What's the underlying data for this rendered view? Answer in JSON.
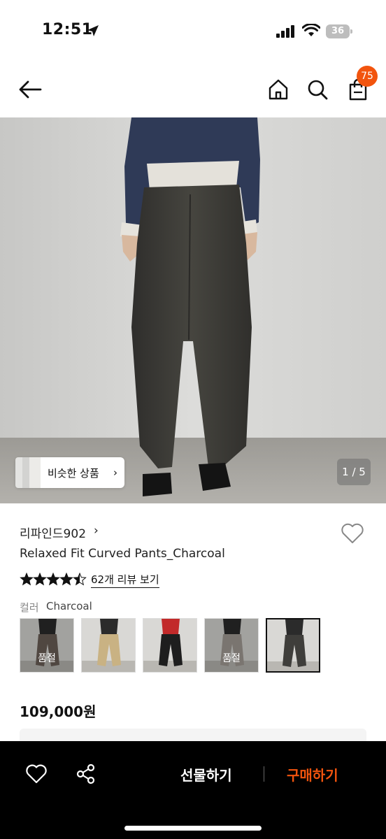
{
  "status_bar": {
    "time": "12:51",
    "battery": "36",
    "icons": [
      "location-arrow-icon",
      "signal-icon",
      "wifi-icon",
      "battery-icon"
    ]
  },
  "nav": {
    "bag_count": "75",
    "icons": [
      "back-arrow-icon",
      "home-icon",
      "search-icon",
      "shopping-bag-icon"
    ]
  },
  "hero": {
    "similar_button_label": "비슷한 상품",
    "similar_chevron": "›",
    "page_counter": "1 / 5"
  },
  "product": {
    "brand": "리파인드902",
    "brand_chevron": "›",
    "name": "Relaxed Fit Curved Pants_Charcoal",
    "rating": 4.5,
    "review_link": "62개 리뷰 보기",
    "color_label": "컬러",
    "color_value": "Charcoal",
    "swatches": [
      {
        "sold_out_label": "품절",
        "sold_out": true,
        "tone": "#6b5f57"
      },
      {
        "sold_out_label": "",
        "sold_out": false,
        "tone": "#c9b283"
      },
      {
        "sold_out_label": "",
        "sold_out": false,
        "tone": "#1e1e1e"
      },
      {
        "sold_out_label": "품절",
        "sold_out": true,
        "tone": "#a39c96"
      },
      {
        "sold_out_label": "",
        "sold_out": false,
        "tone": "#3f3e3b",
        "selected": true
      }
    ],
    "price": "109,000원"
  },
  "bottom_bar": {
    "gift_label": "선물하기",
    "buy_label": "구매하기"
  },
  "colors": {
    "accent": "#f2540e",
    "bottom_bar_bg": "#000000",
    "image_bg": "#d6d6d4",
    "pants": "#3d3c39",
    "shirt": "#2f3a57"
  }
}
